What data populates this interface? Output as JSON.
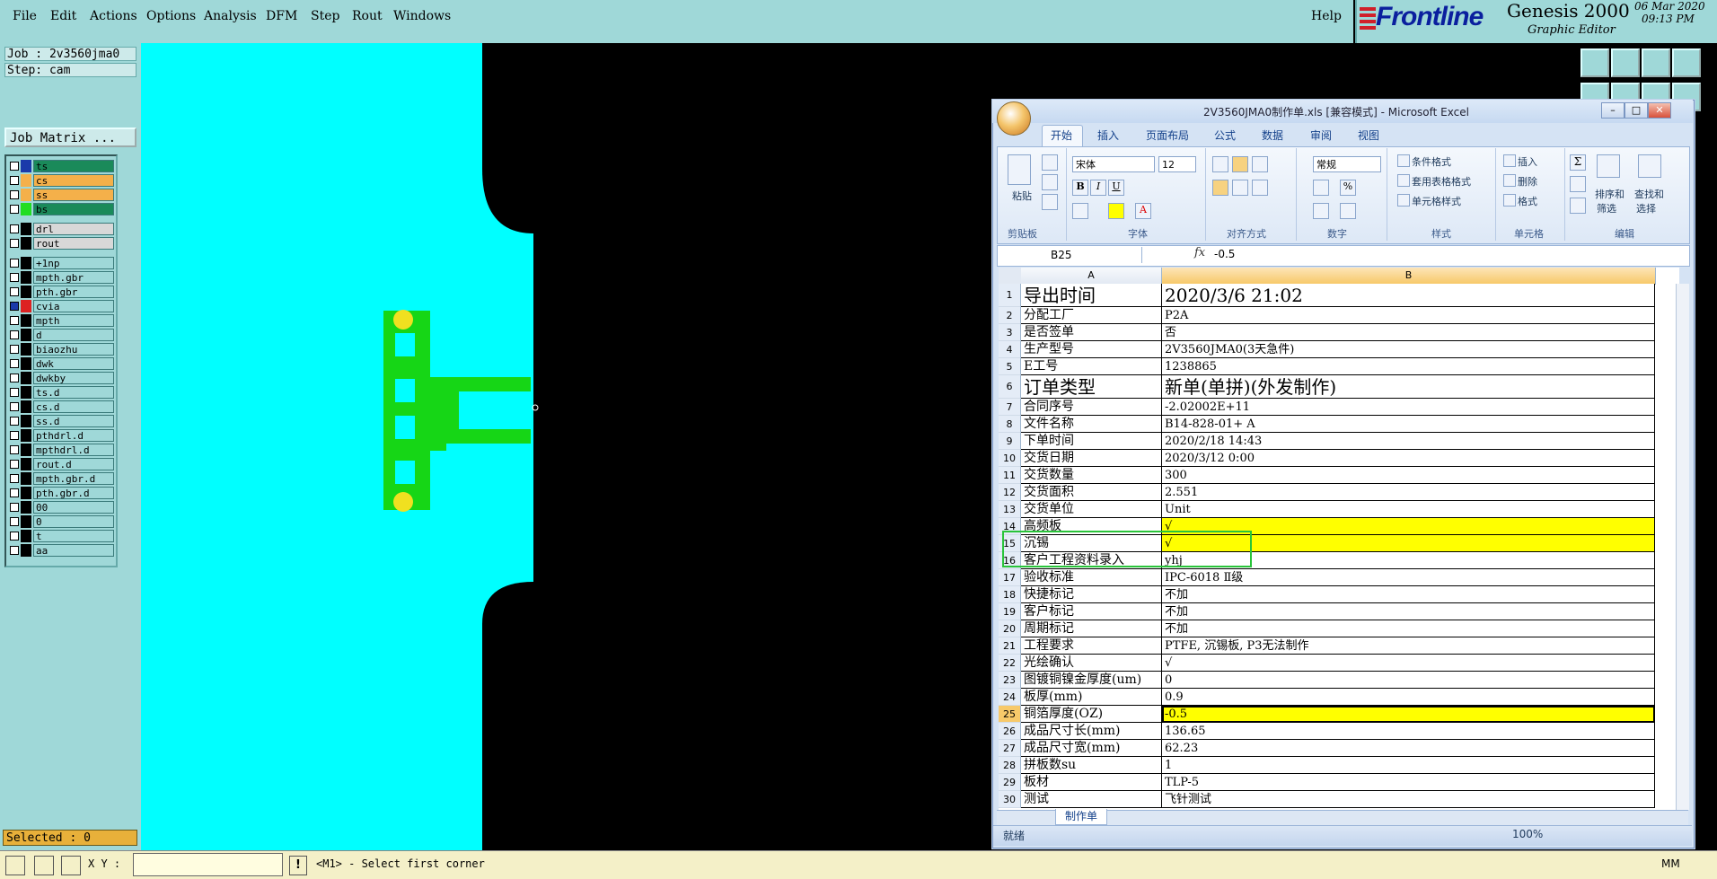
{
  "menubar": {
    "items": [
      "File",
      "Edit",
      "Actions",
      "Options",
      "Analysis",
      "DFM",
      "Step",
      "Rout",
      "Windows"
    ],
    "help": "Help"
  },
  "brand": {
    "logo": "Frontline",
    "product": "Genesis 2000",
    "subtitle": "Graphic Editor",
    "date": "06 Mar 2020",
    "time": "09:13 PM"
  },
  "job": {
    "job_line": "Job : 2v3560jma0",
    "step_line": "Step: cam",
    "matrix_button": "Job Matrix ..."
  },
  "layers": [
    {
      "name": "ts",
      "color": "#1a8a5a",
      "swatch": "#1a3aaa",
      "checked": false
    },
    {
      "name": "cs",
      "color": "#f4b04a",
      "swatch": "#f4b04a",
      "checked": false
    },
    {
      "name": "ss",
      "color": "#f4b04a",
      "swatch": "#f4b04a",
      "checked": false
    },
    {
      "name": "bs",
      "color": "#1a8a5a",
      "swatch": "#22dd22",
      "checked": false
    },
    {
      "name": "drl",
      "color": "#d8d8d8",
      "swatch": "#000000",
      "checked": false
    },
    {
      "name": "rout",
      "color": "#d8d8d8",
      "swatch": "#000000",
      "checked": false
    },
    {
      "name": "+1np",
      "color": "#9fd8d8",
      "swatch": "#000000",
      "checked": false
    },
    {
      "name": "mpth.gbr",
      "color": "#9fd8d8",
      "swatch": "#000000",
      "checked": false
    },
    {
      "name": "pth.gbr",
      "color": "#9fd8d8",
      "swatch": "#000000",
      "checked": false
    },
    {
      "name": "cvia",
      "color": "#9fd8d8",
      "swatch": "#dd2222",
      "checked": true
    },
    {
      "name": "mpth",
      "color": "#9fd8d8",
      "swatch": "#000000",
      "checked": false
    },
    {
      "name": "d",
      "color": "#9fd8d8",
      "swatch": "#000000",
      "checked": false
    },
    {
      "name": "biaozhu",
      "color": "#9fd8d8",
      "swatch": "#000000",
      "checked": false
    },
    {
      "name": "dwk",
      "color": "#9fd8d8",
      "swatch": "#000000",
      "checked": false
    },
    {
      "name": "dwkby",
      "color": "#9fd8d8",
      "swatch": "#000000",
      "checked": false
    },
    {
      "name": "ts.d",
      "color": "#9fd8d8",
      "swatch": "#000000",
      "checked": false
    },
    {
      "name": "cs.d",
      "color": "#9fd8d8",
      "swatch": "#000000",
      "checked": false
    },
    {
      "name": "ss.d",
      "color": "#9fd8d8",
      "swatch": "#000000",
      "checked": false
    },
    {
      "name": "pthdrl.d",
      "color": "#9fd8d8",
      "swatch": "#000000",
      "checked": false
    },
    {
      "name": "mpthdrl.d",
      "color": "#9fd8d8",
      "swatch": "#000000",
      "checked": false
    },
    {
      "name": "rout.d",
      "color": "#9fd8d8",
      "swatch": "#000000",
      "checked": false
    },
    {
      "name": "mpth.gbr.d",
      "color": "#9fd8d8",
      "swatch": "#000000",
      "checked": false
    },
    {
      "name": "pth.gbr.d",
      "color": "#9fd8d8",
      "swatch": "#000000",
      "checked": false
    },
    {
      "name": "00",
      "color": "#9fd8d8",
      "swatch": "#000000",
      "checked": false
    },
    {
      "name": "0",
      "color": "#9fd8d8",
      "swatch": "#000000",
      "checked": false
    },
    {
      "name": "t",
      "color": "#9fd8d8",
      "swatch": "#000000",
      "checked": false
    },
    {
      "name": "aa",
      "color": "#9fd8d8",
      "swatch": "#000000",
      "checked": false
    }
  ],
  "selected": "Selected : 0",
  "bottom": {
    "xy_label": "X Y :",
    "xy_value": "",
    "status": "<M1> - Select first corner",
    "units": "MM"
  },
  "excel": {
    "title": "2V3560JMA0制作单.xls  [兼容模式] - Microsoft Excel",
    "tabs": [
      "开始",
      "插入",
      "页面布局",
      "公式",
      "数据",
      "审阅",
      "视图"
    ],
    "ribbon": {
      "paste": "粘贴",
      "clipboard": "剪贴板",
      "font_name": "宋体",
      "font_size": "12",
      "font_group": "字体",
      "align_group": "对齐方式",
      "number_format": "常规",
      "number_group": "数字",
      "cond_format": "条件格式",
      "table_format": "套用表格格式",
      "cell_style": "单元格样式",
      "style_group": "样式",
      "insert": "插入",
      "delete": "删除",
      "format": "格式",
      "cells_group": "单元格",
      "sort": "排序和",
      "sort2": "筛选",
      "find": "查找和",
      "find2": "选择",
      "edit_group": "编辑"
    },
    "namebox": "B25",
    "formula": "-0.5",
    "col_a": "A",
    "col_b": "B",
    "rows": [
      {
        "n": "1",
        "a": "导出时间",
        "b": "2020/3/6 21:02",
        "big": true
      },
      {
        "n": "2",
        "a": "分配工厂",
        "b": "P2A"
      },
      {
        "n": "3",
        "a": "是否签单",
        "b": "否"
      },
      {
        "n": "4",
        "a": "生产型号",
        "b": "2V3560JMA0(3天急件)"
      },
      {
        "n": "5",
        "a": "E工号",
        "b": "1238865"
      },
      {
        "n": "6",
        "a": "订单类型",
        "b": "新单(单拼)(外发制作)",
        "big": true
      },
      {
        "n": "7",
        "a": "合同序号",
        "b": "-2.02002E+11"
      },
      {
        "n": "8",
        "a": "文件名称",
        "b": "B14-828-01+ A"
      },
      {
        "n": "9",
        "a": "下单时间",
        "b": "2020/2/18 14:43"
      },
      {
        "n": "10",
        "a": "交货日期",
        "b": "2020/3/12 0:00"
      },
      {
        "n": "11",
        "a": "交货数量",
        "b": "300"
      },
      {
        "n": "12",
        "a": "交货面积",
        "b": "2.551"
      },
      {
        "n": "13",
        "a": "交货单位",
        "b": "Unit"
      },
      {
        "n": "14",
        "a": "高频板",
        "b": "√",
        "yellow": true
      },
      {
        "n": "15",
        "a": "沉锡",
        "b": "√",
        "yellow": true
      },
      {
        "n": "16",
        "a": "客户工程资料录入",
        "b": "yhj"
      },
      {
        "n": "17",
        "a": "验收标准",
        "b": "IPC-6018 Ⅱ级"
      },
      {
        "n": "18",
        "a": "快捷标记",
        "b": "不加"
      },
      {
        "n": "19",
        "a": "客户标记",
        "b": "不加"
      },
      {
        "n": "20",
        "a": "周期标记",
        "b": "不加"
      },
      {
        "n": "21",
        "a": "工程要求",
        "b": "PTFE, 沉锡板, P3无法制作"
      },
      {
        "n": "22",
        "a": "光绘确认",
        "b": "√"
      },
      {
        "n": "23",
        "a": "图镀铜镍金厚度(um)",
        "b": "0"
      },
      {
        "n": "24",
        "a": "板厚(mm)",
        "b": "0.9"
      },
      {
        "n": "25",
        "a": "铜箔厚度(OZ)",
        "b": "-0.5",
        "yellow": true,
        "selected": true
      },
      {
        "n": "26",
        "a": "成品尺寸长(mm)",
        "b": "136.65"
      },
      {
        "n": "27",
        "a": "成品尺寸宽(mm)",
        "b": "62.23"
      },
      {
        "n": "28",
        "a": "拼板数su",
        "b": "1"
      },
      {
        "n": "29",
        "a": "板材",
        "b": "TLP-5"
      },
      {
        "n": "30",
        "a": "测试",
        "b": "飞针测试"
      }
    ],
    "sheet_tab": "制作单",
    "status": "就绪",
    "zoom": "100%"
  }
}
